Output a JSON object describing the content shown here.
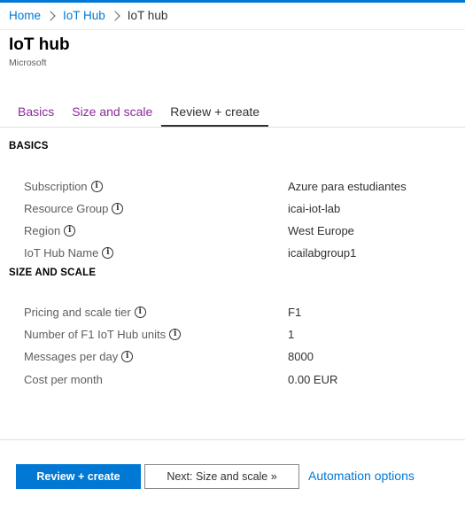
{
  "breadcrumb": {
    "items": [
      "Home",
      "IoT Hub",
      "IoT hub"
    ]
  },
  "page": {
    "title": "IoT hub",
    "subtitle": "Microsoft"
  },
  "tabs": [
    {
      "label": "Basics",
      "active": false
    },
    {
      "label": "Size and scale",
      "active": false
    },
    {
      "label": "Review + create",
      "active": true
    }
  ],
  "basics": {
    "title": "BASICS",
    "rows": [
      {
        "label": "Subscription",
        "value": "Azure para estudiantes"
      },
      {
        "label": "Resource Group",
        "value": "icai-iot-lab"
      },
      {
        "label": "Region",
        "value": "West Europe"
      },
      {
        "label": "IoT Hub Name",
        "value": "icailabgroup1"
      }
    ]
  },
  "size_scale": {
    "title": "SIZE AND SCALE",
    "rows": [
      {
        "label": "Pricing and scale tier",
        "value": "F1",
        "info": true
      },
      {
        "label": "Number of F1 IoT Hub units",
        "value": "1",
        "info": true
      },
      {
        "label": "Messages per day",
        "value": "8000",
        "info": true
      },
      {
        "label": "Cost per month",
        "value": "0.00 EUR",
        "info": false
      }
    ]
  },
  "footer": {
    "review_create": "Review + create",
    "next": "Next: Size and scale »",
    "automation": "Automation options"
  },
  "colors": {
    "accent": "#0078d4",
    "tab_link": "#8c2a9c"
  },
  "icons": {
    "info": "i"
  }
}
